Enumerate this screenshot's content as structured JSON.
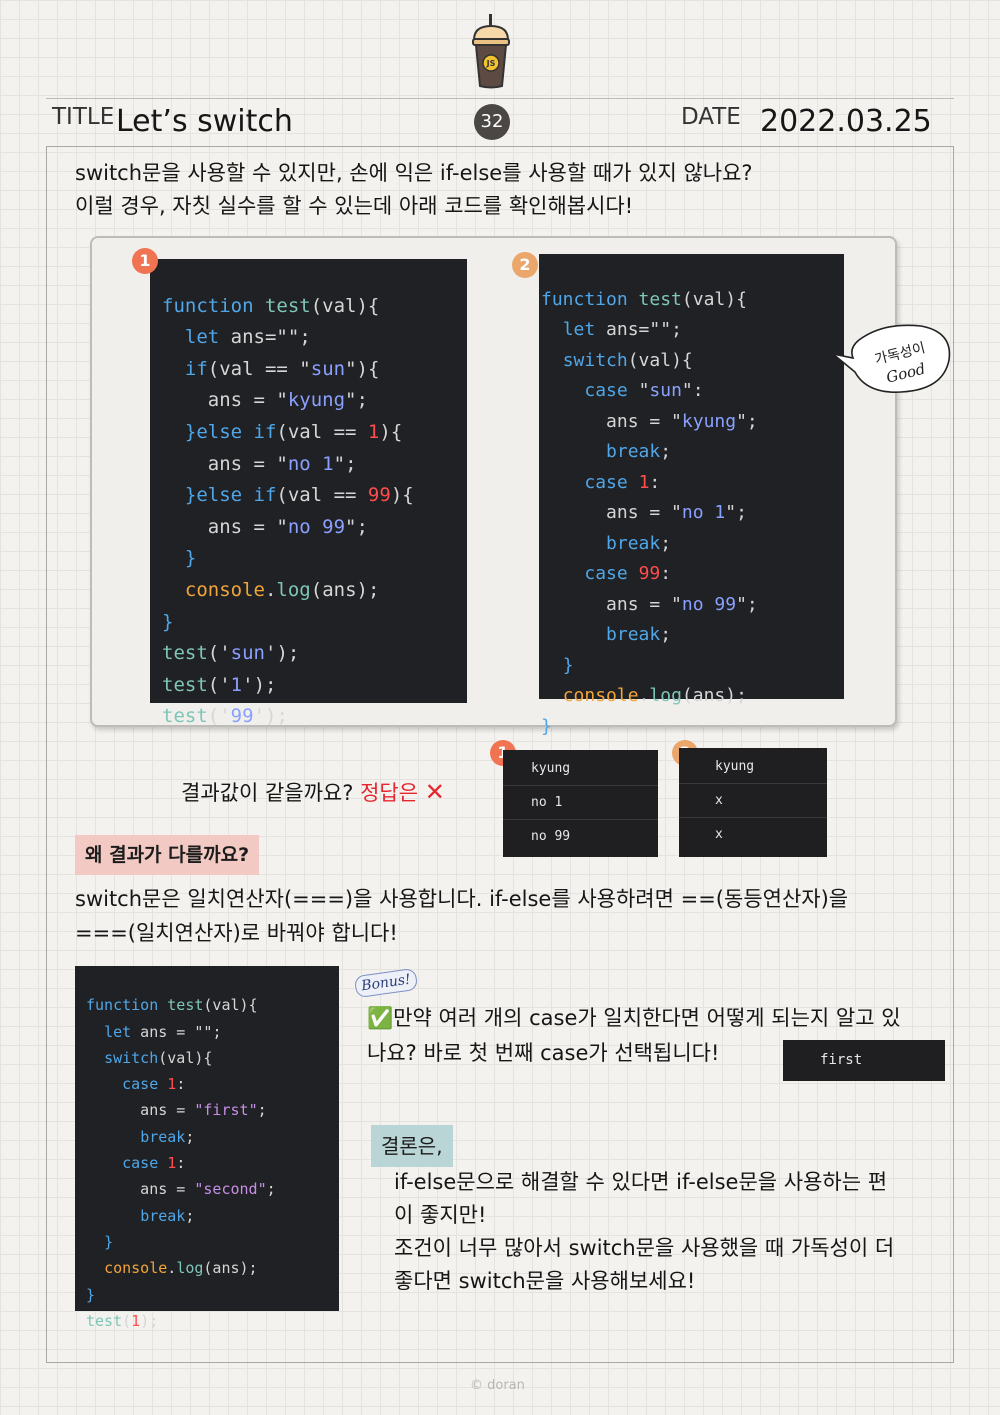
{
  "header": {
    "cup_label": "JS",
    "title_label": "TITLE",
    "title": "Let’s switch",
    "page_number": "32",
    "date_label": "DATE",
    "date": "2022.03.25"
  },
  "intro": {
    "line1": "switch문을 사용할 수 있지만, 손에 익은 if-else를 사용할 때가 있지 않나요?",
    "line2": "이럴 경우, 자칫 실수를 할 수 있는데 아래 코드를 확인해봅시다!"
  },
  "badges": {
    "one": "1",
    "two": "2"
  },
  "bubble": {
    "line1": "가독성이",
    "line2": "Good"
  },
  "question": {
    "text": "결과값이 같을까요?",
    "answer_label": "정답은",
    "answer_mark": "✕"
  },
  "output1": [
    "kyung",
    "no 1",
    "no 99"
  ],
  "output2": [
    "kyung",
    "x",
    "x"
  ],
  "why": {
    "heading": "왜 결과가 다를까요?",
    "line1": "switch문은 일치연산자(===)을 사용합니다. if-else를 사용하려면 ==(동등연산자)을",
    "line2": "===(일치연산자)로 바꿔야 합니다!"
  },
  "bonus": {
    "label": "Bonus!",
    "check": "✅",
    "line1": "만약 여러 개의 case가 일치한다면 어떻게 되는지 알고 있",
    "line2": "나요? 바로 첫 번째 case가 선택됩니다!",
    "output": "first"
  },
  "conclusion": {
    "heading": "결론은,",
    "line1": "if-else문으로 해결할 수 있다면 if-else문을 사용하는 편",
    "line2": "이 좋지만!",
    "line3": "조건이 너무 많아서 switch문을 사용했을 때 가독성이 더",
    "line4": "좋다면 switch문을 사용해보세요!"
  },
  "footer": {
    "copyright": "© doran"
  },
  "colors": {
    "code_bg": "#202124",
    "keyword": "#4fa6e8",
    "function": "#7ec6b8",
    "string": "#8aa0ff",
    "number": "#ff4d4d",
    "console": "#f1a53a",
    "badge_one": "#f07452",
    "badge_two": "#eba66c",
    "heading_pink": "#f2c9c3",
    "heading_teal": "#b9d5d6"
  }
}
